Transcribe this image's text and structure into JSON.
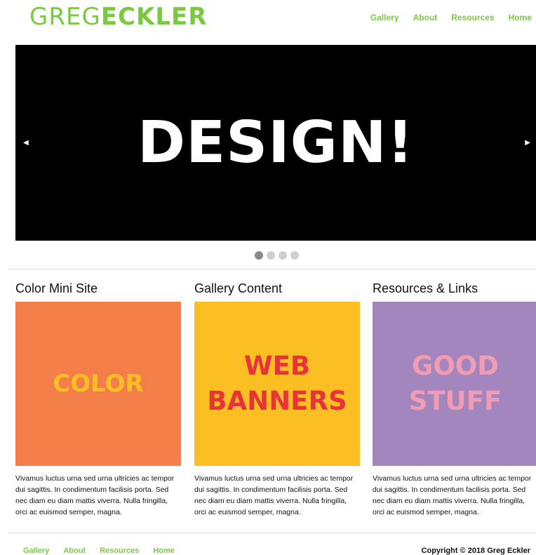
{
  "header": {
    "logo_thin": "GREG",
    "logo_bold": "ECKLER",
    "nav": [
      "Gallery",
      "About",
      "Resources",
      "Home"
    ]
  },
  "slider": {
    "text": "DESIGN!",
    "prev_glyph": "◀",
    "next_glyph": "▶",
    "dot_count": 4,
    "active_dot": 1
  },
  "columns": [
    {
      "title": "Color Mini Site",
      "tile_line1": "COLOR",
      "tile_line2": "",
      "tile_bg": "#f47e48",
      "tile_fg": "#fbbe23",
      "desc": "Vivamus luctus urna sed urna ultricies ac tempor dui sagittis. In condimentum facilisis porta. Sed nec diam eu diam mattis viverra. Nulla fringilla, orci ac euismod semper, magna."
    },
    {
      "title": "Gallery Content",
      "tile_line1": "WEB",
      "tile_line2": "BANNERS",
      "tile_bg": "#fbbe23",
      "tile_fg": "#e8333b",
      "desc": "Vivamus luctus urna sed urna ultricies ac tempor dui sagittis. In condimentum facilisis porta. Sed nec diam eu diam mattis viverra. Nulla fringilla, orci ac euismod semper, magna."
    },
    {
      "title": "Resources & Links",
      "tile_line1": "GOOD",
      "tile_line2": "STUFF",
      "tile_bg": "#a286bd",
      "tile_fg": "#f29cb3",
      "desc": "Vivamus luctus urna sed urna ultricies ac tempor dui sagittis. In condimentum facilisis porta. Sed nec diam eu diam mattis viverra. Nulla fringilla, orci ac euismod semper, magna."
    }
  ],
  "footer": {
    "nav": [
      "Gallery",
      "About",
      "Resources",
      "Home"
    ],
    "copyright": "Copyright © 2018 Greg Eckler"
  },
  "colors": {
    "accent": "#7ac943",
    "slider_bg": "#000000"
  }
}
